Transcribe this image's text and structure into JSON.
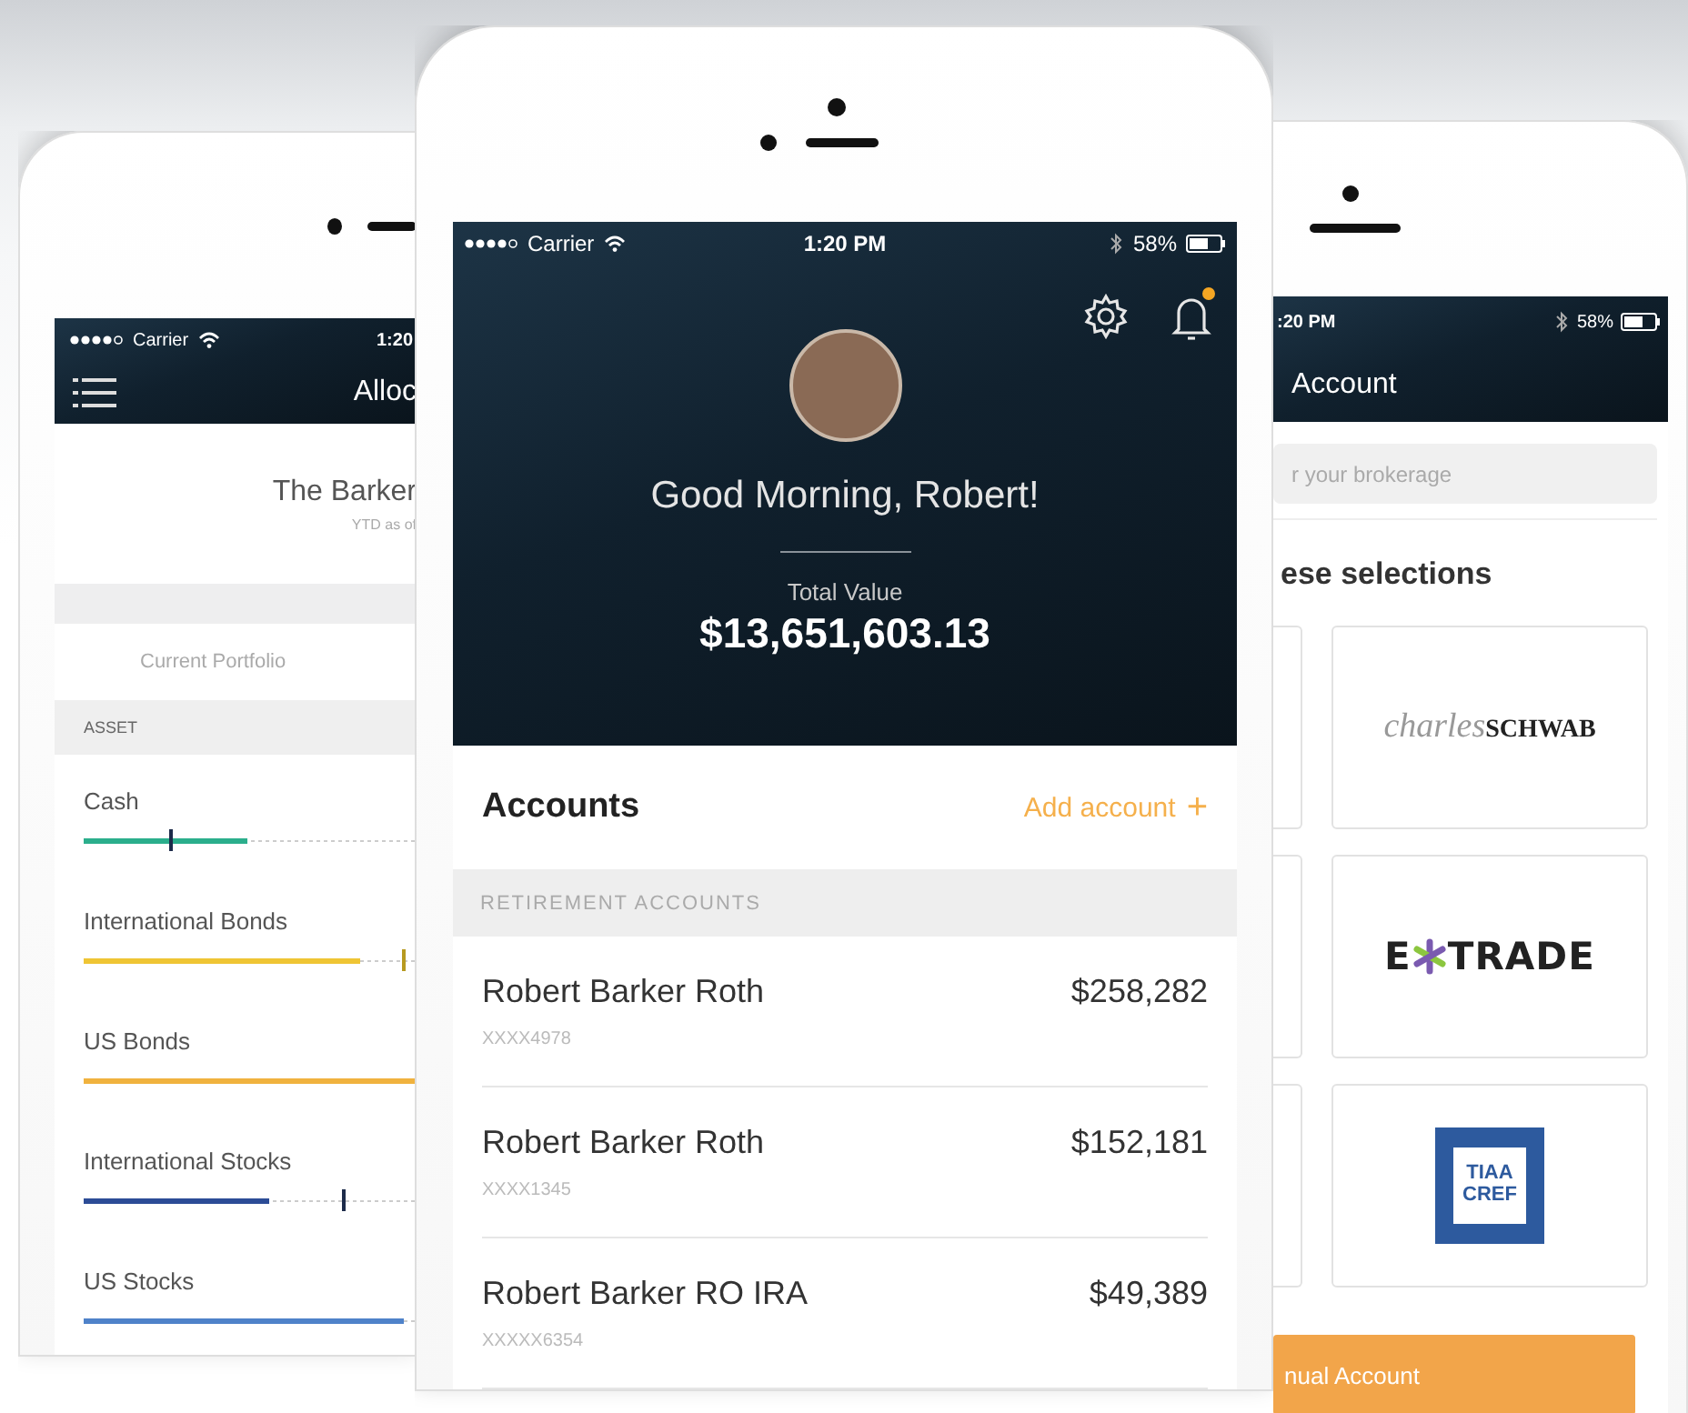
{
  "allocation_screen": {
    "status_bar": {
      "carrier": "Carrier",
      "time": "1:20"
    },
    "title": "Alloc",
    "portfolio_name": "The Barker",
    "subtitle": "YTD as of",
    "tab_label": "Current Portfolio",
    "column_header": "ASSET",
    "assets": [
      {
        "name": "Cash",
        "color": "#2bae8c",
        "level": 0.49,
        "target": {
          "level": 0.26
        }
      },
      {
        "name": "International Bonds",
        "color": "#efc534",
        "level": 0.83,
        "target": {
          "level": 0.96
        }
      },
      {
        "name": "US Bonds",
        "color": "#f0b23e",
        "level": 1.0
      },
      {
        "name": "International Stocks",
        "color": "#2c4c96",
        "level": 0.56,
        "target": {
          "level": 0.78
        }
      },
      {
        "name": "US Stocks",
        "color": "#4f82c9",
        "level": 0.96
      }
    ]
  },
  "home_screen": {
    "status_bar": {
      "carrier": "Carrier",
      "time": "1:20 PM",
      "battery": "58%"
    },
    "notifications": {
      "unread": true
    },
    "greeting": "Good Morning, Robert!",
    "total_label": "Total Value",
    "total_value": "$13,651,603.13",
    "accounts_title": "Accounts",
    "add_account": {
      "label": "Add account",
      "icon": "+"
    },
    "sections": [
      {
        "title": "RETIREMENT ACCOUNTS",
        "accounts": [
          {
            "name": "Robert Barker Roth",
            "number": "XXXX4978",
            "balance": "$258,282"
          },
          {
            "name": "Robert Barker Roth",
            "number": "XXXX1345",
            "balance": "$152,181"
          },
          {
            "name": "Robert Barker RO IRA",
            "number": "XXXXX6354",
            "balance": "$49,389"
          }
        ]
      }
    ]
  },
  "broker_screen": {
    "status_bar": {
      "time": ":20 PM",
      "battery": "58%"
    },
    "title": "Account",
    "search": {
      "placeholder": "r your brokerage"
    },
    "section_title": "ese selections",
    "brokerages": [
      {
        "kind": "schwab",
        "parts": [
          "charles",
          "SCHWAB"
        ]
      },
      {
        "kind": "etrade",
        "parts": [
          "E",
          "TRADE"
        ]
      },
      {
        "kind": "tiaa",
        "parts": [
          "TIAA",
          "CREF"
        ]
      }
    ],
    "manual_button": "nual Account"
  }
}
